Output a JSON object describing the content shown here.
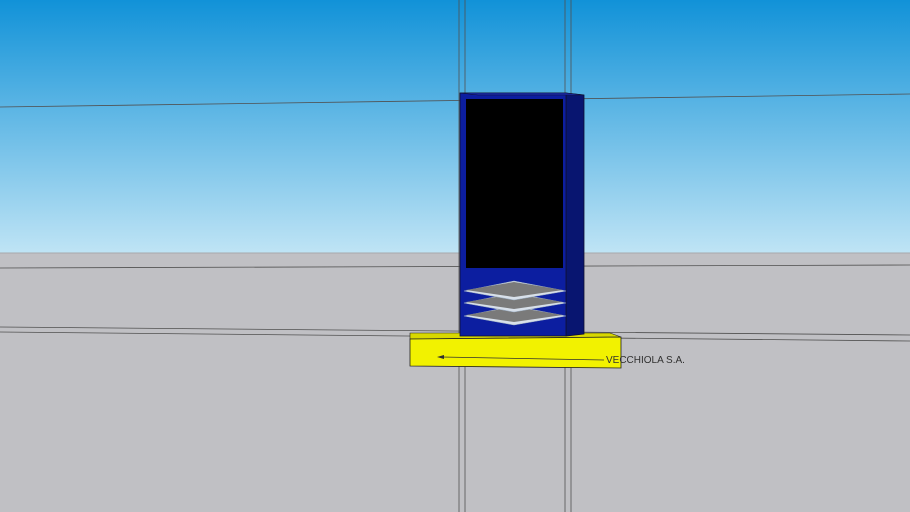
{
  "scene": {
    "sky_top_color": "#1192d8",
    "sky_bottom_color": "#bfe4f5",
    "ground_color": "#c0c0c4",
    "model": {
      "cabinet_front_color": "#0c1ea0",
      "cabinet_side_color": "#081570",
      "screen_color": "#000000",
      "base_color": "#f2f200",
      "layers_icon": "stacked-layers-icon"
    },
    "annotation": {
      "text": "VECCHIOLA S.A."
    }
  }
}
